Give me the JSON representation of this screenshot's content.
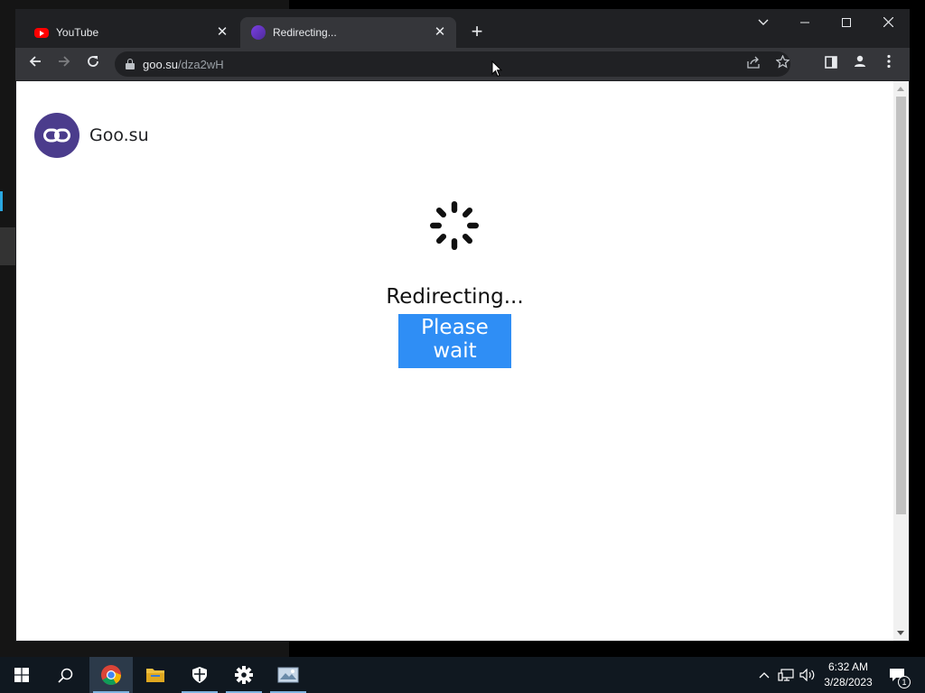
{
  "browser": {
    "tabs": [
      {
        "title": "YouTube",
        "favicon": "youtube-icon",
        "active": false
      },
      {
        "title": "Redirecting...",
        "favicon": "goo-su-icon",
        "active": true
      }
    ],
    "new_tab_symbol": "+",
    "window_controls": {
      "dropdown": "⌄",
      "minimize": "—",
      "maximize": "☐",
      "close": "✕"
    },
    "address": {
      "host": "goo.su",
      "path": "/dza2wH"
    }
  },
  "page": {
    "brand_name": "Goo.su",
    "heading": "Redirecting...",
    "subheading": "Please wait",
    "selection_color": "#2f8ef5"
  },
  "taskbar": {
    "apps": [
      "start-icon",
      "search-icon",
      "chrome-icon",
      "file-explorer-icon",
      "windows-security-icon",
      "settings-icon",
      "photos-icon"
    ],
    "clock_time": "6:32 AM",
    "clock_date": "3/28/2023",
    "notification_count": "1"
  }
}
